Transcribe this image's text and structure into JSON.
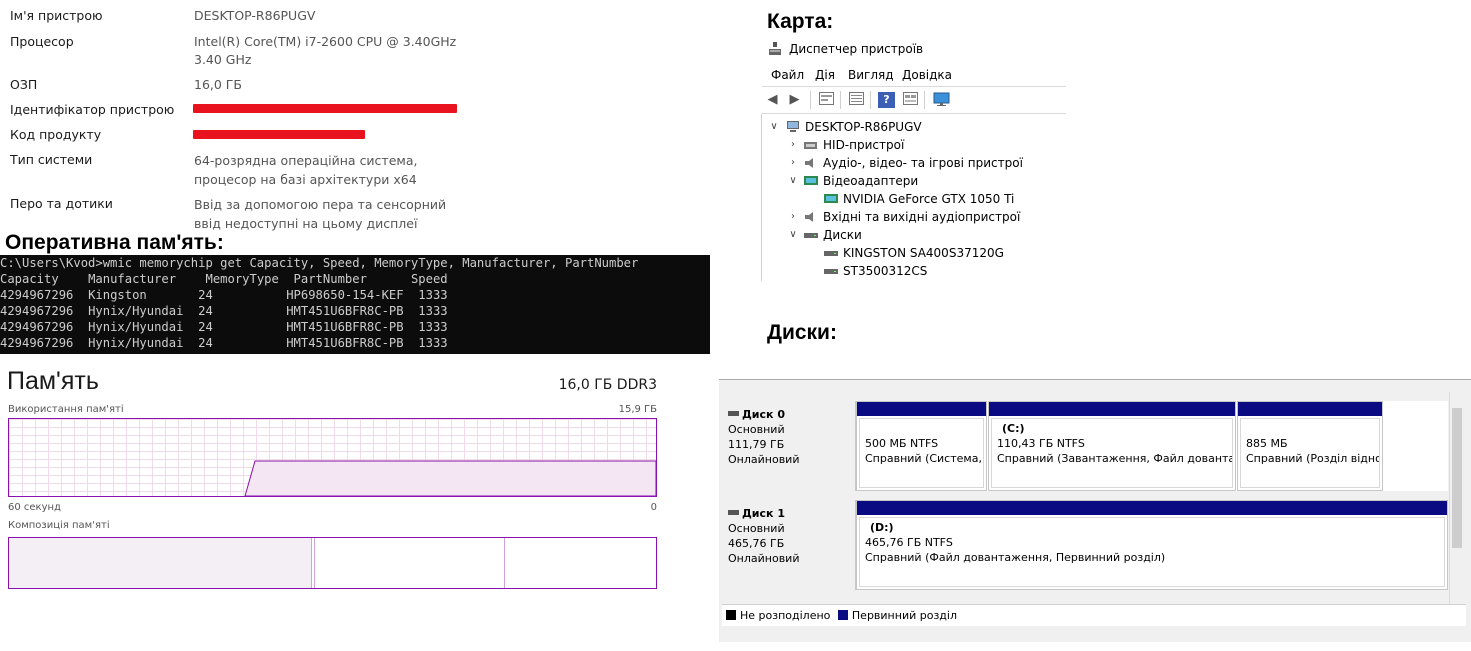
{
  "system_info": [
    {
      "label": "Ім'я пристрою",
      "value": "DESKTOP-R86PUGV"
    },
    {
      "label": "Процесор",
      "value": "Intel(R) Core(TM) i7-2600 CPU @ 3.40GHz",
      "value2": "3.40 GHz"
    },
    {
      "label": "ОЗП",
      "value": "16,0 ГБ"
    },
    {
      "label": "Ідентифікатор пристрою"
    },
    {
      "label": "Код продукту"
    },
    {
      "label": "Тип системи",
      "value": "64-розрядна операційна система,",
      "value2": "процесор на базі архітектури x64"
    },
    {
      "label": "Перо та дотики",
      "value": "Ввід за допомогою пера та сенсорний",
      "value2": "ввід недоступні на цьому дисплеї"
    }
  ],
  "headings": {
    "ram": "Оперативна пам'ять:",
    "card": "Карта:",
    "disks": "Диски:"
  },
  "terminal": {
    "command": "C:\\Users\\Kvod>wmic memorychip get Capacity, Speed, MemoryType, Manufacturer, PartNumber",
    "columns": [
      "Capacity",
      "Manufacturer",
      "MemoryType",
      "PartNumber",
      "Speed"
    ],
    "rows": [
      [
        "4294967296",
        "Kingston",
        "24",
        "HP698650-154-KEF",
        "1333"
      ],
      [
        "4294967296",
        "Hynix/Hyundai",
        "24",
        "HMT451U6BFR8C-PB",
        "1333"
      ],
      [
        "4294967296",
        "Hynix/Hyundai",
        "24",
        "HMT451U6BFR8C-PB",
        "1333"
      ],
      [
        "4294967296",
        "Hynix/Hyundai",
        "24",
        "HMT451U6BFR8C-PB",
        "1333"
      ]
    ]
  },
  "memory": {
    "title": "Пам'ять",
    "total": "16,0 ГБ DDR3",
    "usage_label": "Використання пам'яті",
    "usage_max": "15,9 ГБ",
    "time_left": "60 секунд",
    "time_right": "0",
    "composition_label": "Композиція пам'яті",
    "accent_color": "#8b12ae",
    "graph_fill_color": "#f4e6f2",
    "usage_level_fraction": 0.45,
    "usage_start_fraction": 0.38
  },
  "device_manager": {
    "title": "Диспетчер пристроїв",
    "menu": [
      "Файл",
      "Дія",
      "Вигляд",
      "Довідка"
    ],
    "toolbar_icons": [
      "back-arrow-icon",
      "forward-arrow-icon",
      "device-view-icon",
      "properties-icon",
      "help-icon",
      "device-list-icon",
      "monitor-icon"
    ],
    "tree": {
      "root": "DESKTOP-R86PUGV",
      "hid": "HID-пристрої",
      "audio": "Аудіо-, відео- та ігрові пристрої",
      "video": "Відеоадаптери",
      "gpu": "NVIDIA GeForce GTX 1050 Ti",
      "audio_io": "Вхідні та вихідні аудіопристрої",
      "disks": "Диски",
      "disk1": "KINGSTON SA400S37120G",
      "disk2": "ST3500312CS"
    }
  },
  "disk_management": {
    "disks": [
      {
        "name": "Диск 0",
        "type": "Основний",
        "size": "111,79 ГБ",
        "status": "Онлайновий",
        "partitions": [
          {
            "letter": "",
            "size": "500 МБ NTFS",
            "status": "Справний (Система, ..."
          },
          {
            "letter": "(C:)",
            "size": "110,43 ГБ NTFS",
            "status": "Справний (Завантаження, Файл довантаження"
          },
          {
            "letter": "",
            "size": "885 МБ",
            "status": "Справний (Розділ відновлення"
          }
        ]
      },
      {
        "name": "Диск 1",
        "type": "Основний",
        "size": "465,76 ГБ",
        "status": "Онлайновий",
        "partitions": [
          {
            "letter": "(D:)",
            "size": "465,76 ГБ NTFS",
            "status": "Справний (Файл довантаження, Первинний розділ)"
          }
        ]
      }
    ],
    "legend": [
      {
        "label": "Не розподілено",
        "color": "#000000"
      },
      {
        "label": "Первинний розділ",
        "color": "#0a0a82"
      }
    ]
  }
}
